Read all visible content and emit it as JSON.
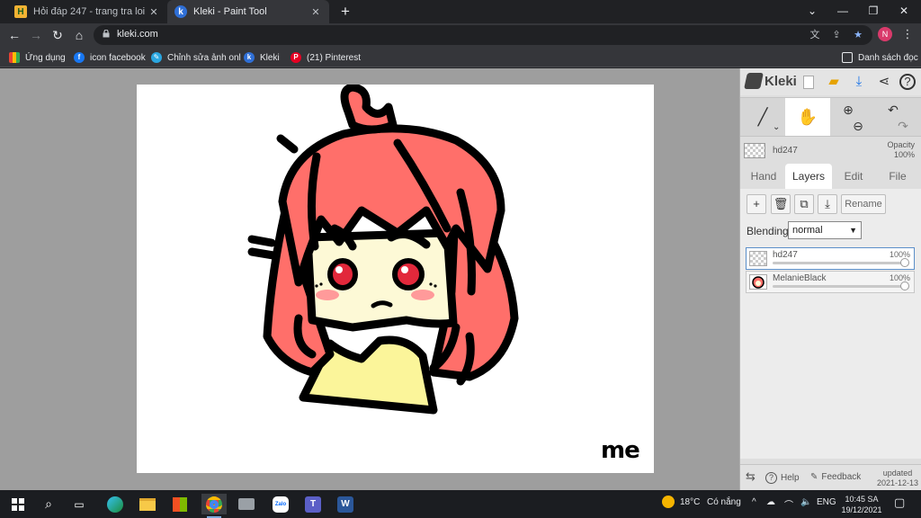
{
  "browser": {
    "tabs": [
      {
        "title": "Hỏi đáp 247 - trang tra loi",
        "active": false,
        "favicon": "hd247-icon"
      },
      {
        "title": "Kleki - Paint Tool",
        "active": true,
        "favicon": "kleki-icon"
      }
    ],
    "url": "kleki.com",
    "profile_initial": "N",
    "bookmarks": [
      {
        "label": "Ứng dụng",
        "icon": "apps-grid-icon"
      },
      {
        "label": "icon facebook",
        "icon": "facebook-icon"
      },
      {
        "label": "Chỉnh sửa ảnh onl",
        "icon": "photo-edit-icon"
      },
      {
        "label": "Kleki",
        "icon": "kleki-icon"
      },
      {
        "label": "(21) Pinterest",
        "icon": "pinterest-icon"
      }
    ],
    "reading_list": "Danh sách đọc"
  },
  "kleki": {
    "logo": "Kleki",
    "layer_info": {
      "name": "hd247",
      "opacity_label": "Opacity",
      "opacity_value": "100%"
    },
    "tabs": [
      {
        "label": "Hand",
        "active": false
      },
      {
        "label": "Layers",
        "active": true
      },
      {
        "label": "Edit",
        "active": false
      },
      {
        "label": "File",
        "active": false
      }
    ],
    "rename_label": "Rename",
    "blending_label": "Blending",
    "blending_value": "normal",
    "layers": [
      {
        "name": "hd247",
        "opacity": "100%",
        "opacity_value": 1.0,
        "selected": true
      },
      {
        "name": "MelanieBlack",
        "opacity": "100%",
        "opacity_value": 1.0,
        "selected": false
      }
    ],
    "bottom": {
      "help": "Help",
      "feedback": "Feedback",
      "updated_label": "updated",
      "updated_date": "2021-12-13"
    },
    "canvas_text": "me"
  },
  "taskbar": {
    "weather_temp": "18°C",
    "weather_desc": "Có nắng",
    "language": "ENG",
    "time": "10:45 SA",
    "date": "19/12/2021"
  }
}
